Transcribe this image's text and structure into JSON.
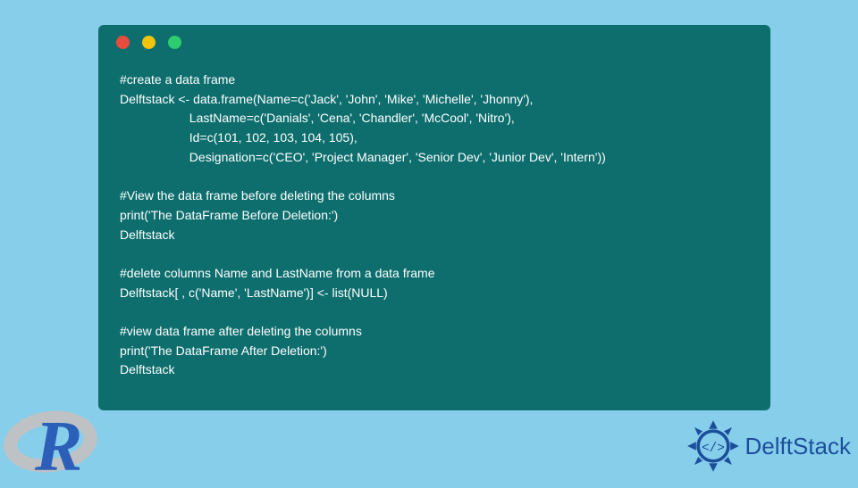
{
  "code_lines": [
    "#create a data frame",
    "Delftstack <- data.frame(Name=c('Jack', 'John', 'Mike', 'Michelle', 'Jhonny'),",
    "                    LastName=c('Danials', 'Cena', 'Chandler', 'McCool', 'Nitro'),",
    "                    Id=c(101, 102, 103, 104, 105),",
    "                    Designation=c('CEO', 'Project Manager', 'Senior Dev', 'Junior Dev', 'Intern'))",
    "",
    "#View the data frame before deleting the columns",
    "print('The DataFrame Before Deletion:')",
    "Delftstack",
    "",
    "#delete columns Name and LastName from a data frame",
    "Delftstack[ , c('Name', 'LastName')] <- list(NULL)",
    "",
    "#view data frame after deleting the columns",
    "print('The DataFrame After Deletion:')",
    "Delftstack"
  ],
  "brand": {
    "name": "DelftStack"
  }
}
